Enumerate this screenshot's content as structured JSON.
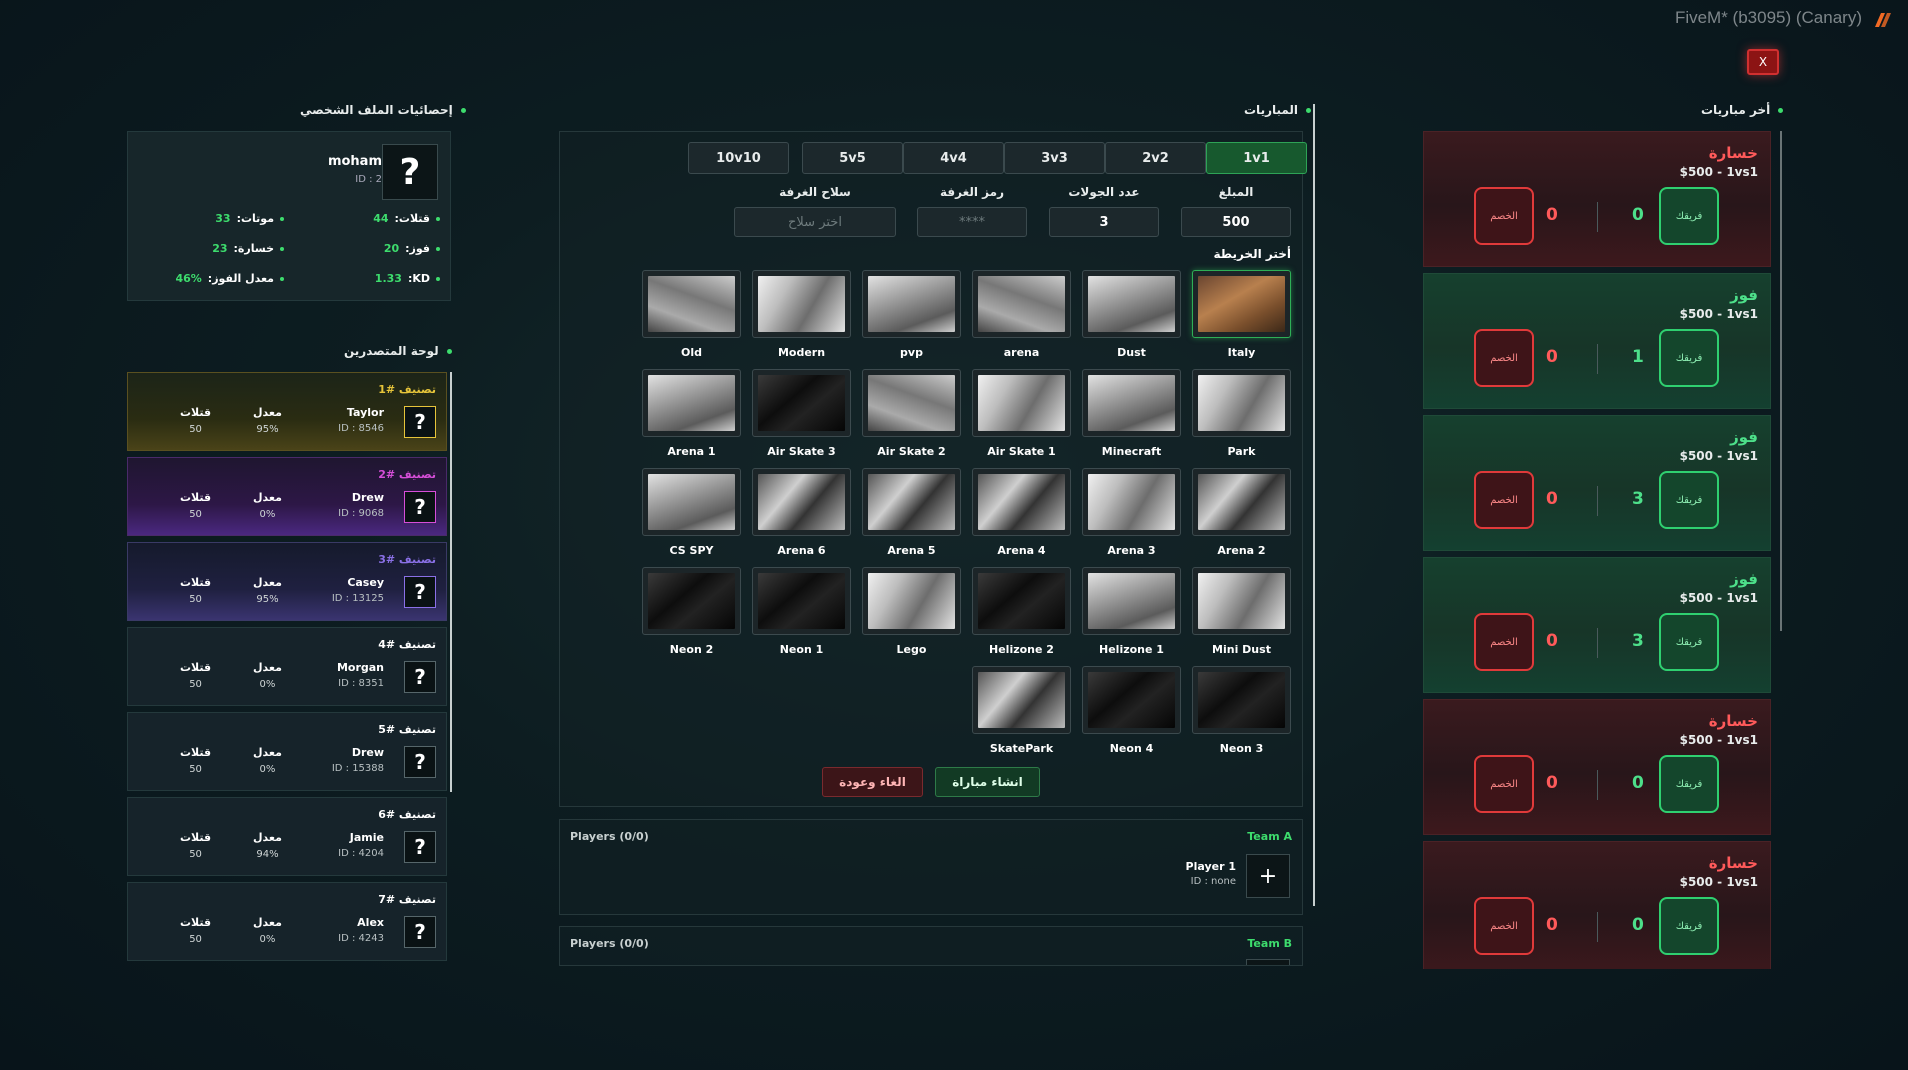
{
  "window": {
    "title": "FiveM* (b3095) (Canary)",
    "close_label": "X"
  },
  "sections": {
    "profile": "إحصائيات الملف الشخصي",
    "leaderboard": "لوحة المتصدرين",
    "matches": "المباريات",
    "recent": "أخر مباريات"
  },
  "profile": {
    "avatar": "?",
    "name": "moham",
    "id": "ID : 2",
    "stats": [
      {
        "label": "قتلات:",
        "value": "44"
      },
      {
        "label": "موتات:",
        "value": "33"
      },
      {
        "label": "فوز:",
        "value": "20"
      },
      {
        "label": "خسارة:",
        "value": "23"
      },
      {
        "label": "KD:",
        "value": "1.33"
      },
      {
        "label": "معدل الفوز:",
        "value": "46%"
      }
    ]
  },
  "leaderboard": {
    "col_rate": "معدل",
    "col_kills": "قتلات",
    "items": [
      {
        "rank": "تصنيف #1",
        "rank_color": "#e6c43a",
        "name": "Taylor",
        "id": "ID : 8546",
        "rate": "95%",
        "kills": "50"
      },
      {
        "rank": "تصنيف #2",
        "rank_color": "#d64ed8",
        "name": "Drew",
        "id": "ID : 9068",
        "rate": "0%",
        "kills": "50"
      },
      {
        "rank": "تصنيف #3",
        "rank_color": "#8a70e6",
        "name": "Casey",
        "id": "ID : 13125",
        "rate": "95%",
        "kills": "50"
      },
      {
        "rank": "تصنيف #4",
        "rank_color": "#ffffff",
        "name": "Morgan",
        "id": "ID : 8351",
        "rate": "0%",
        "kills": "50"
      },
      {
        "rank": "تصنيف #5",
        "rank_color": "#ffffff",
        "name": "Drew",
        "id": "ID : 15388",
        "rate": "0%",
        "kills": "50"
      },
      {
        "rank": "تصنيف #6",
        "rank_color": "#ffffff",
        "name": "Jamie",
        "id": "ID : 4204",
        "rate": "94%",
        "kills": "50"
      },
      {
        "rank": "تصنيف #7",
        "rank_color": "#ffffff",
        "name": "Alex",
        "id": "ID : 4243",
        "rate": "0%",
        "kills": "50"
      }
    ]
  },
  "match": {
    "modes": [
      "1v1",
      "2v2",
      "3v3",
      "4v4",
      "5v5",
      "10v10"
    ],
    "active_mode": "1v1",
    "fields": {
      "amount_label": "المبلغ",
      "amount_value": "500",
      "rounds_label": "عدد الجولات",
      "rounds_value": "3",
      "code_label": "رمز الغرفة",
      "code_placeholder": "****",
      "weapon_label": "سلاح الغرفة",
      "weapon_placeholder": "اختر سلاح"
    },
    "map_title": "أختر الخريطة",
    "maps": [
      "Italy",
      "Dust",
      "arena",
      "pvp",
      "Modern",
      "Old",
      "Park",
      "Minecraft",
      "Air Skate 1",
      "Air Skate 2",
      "Air Skate 3",
      "Arena 1",
      "Arena 2",
      "Arena 3",
      "Arena 4",
      "Arena 5",
      "Arena 6",
      "CS SPY",
      "Mini Dust",
      "Helizone 1",
      "Helizone 2",
      "Lego",
      "Neon 1",
      "Neon 2",
      "Neon 3",
      "Neon 4",
      "SkatePark"
    ],
    "selected_map": "Italy",
    "create_label": "انشاء مباراة",
    "cancel_label": "الغاء وعودة"
  },
  "teams": [
    {
      "name": "Team A",
      "players": "Players (0/0)",
      "slot_name": "Player 1",
      "slot_id": "ID : none"
    },
    {
      "name": "Team B",
      "players": "Players (0/0)"
    }
  ],
  "recent": {
    "team_label": "فريقك",
    "enemy_label": "الخصم",
    "items": [
      {
        "result": "خسارة",
        "kind": "loss",
        "detail": "$500 - 1vs1",
        "team_score": "0",
        "enemy_score": "0"
      },
      {
        "result": "فوز",
        "kind": "win",
        "detail": "$500 - 1vs1",
        "team_score": "1",
        "enemy_score": "0"
      },
      {
        "result": "فوز",
        "kind": "win",
        "detail": "$500 - 1vs1",
        "team_score": "3",
        "enemy_score": "0"
      },
      {
        "result": "فوز",
        "kind": "win",
        "detail": "$500 - 1vs1",
        "team_score": "3",
        "enemy_score": "0"
      },
      {
        "result": "خسارة",
        "kind": "loss",
        "detail": "$500 - 1vs1",
        "team_score": "0",
        "enemy_score": "0"
      },
      {
        "result": "خسارة",
        "kind": "loss",
        "detail": "$500 - 1vs1",
        "team_score": "0",
        "enemy_score": "0"
      }
    ]
  },
  "colors": {
    "accent": "#3ddc6d",
    "loss": "#ff5a5a",
    "win": "#4de08a"
  }
}
